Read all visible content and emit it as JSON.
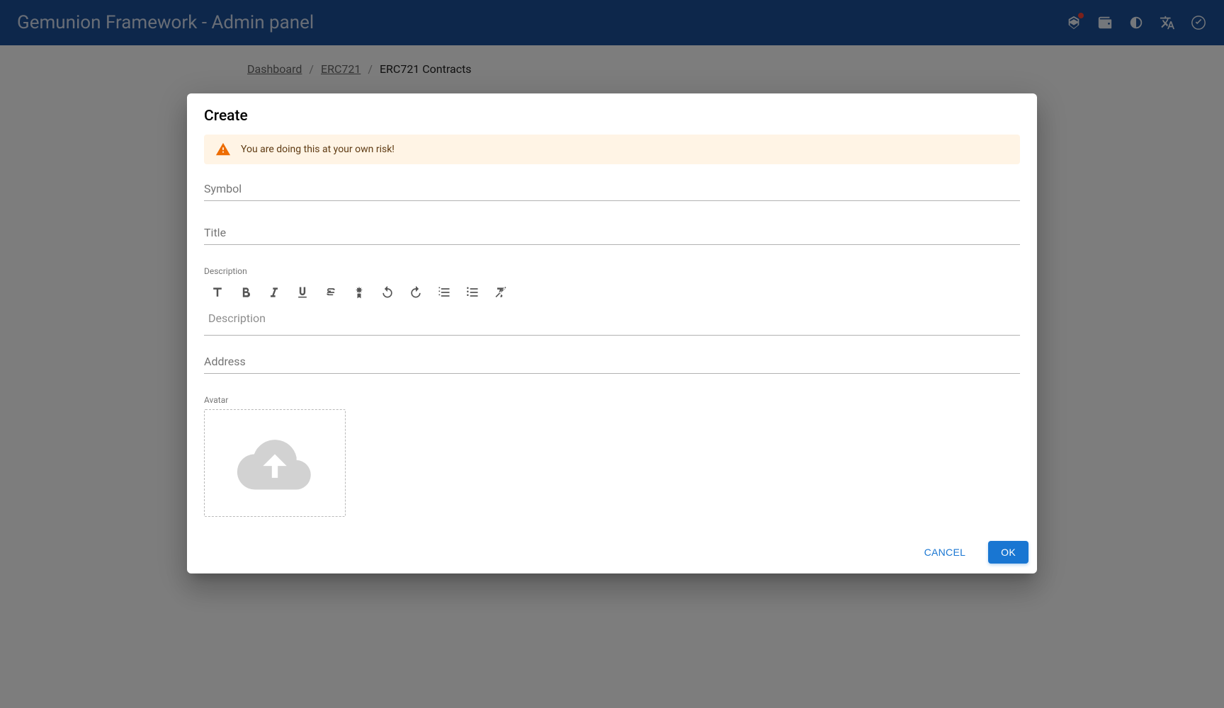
{
  "header": {
    "title": "Gemunion Framework - Admin panel"
  },
  "breadcrumb": {
    "items": [
      "Dashboard",
      "ERC721",
      "ERC721 Contracts"
    ]
  },
  "dialog": {
    "title": "Create",
    "warning": "You are doing this at your own risk!",
    "fields": {
      "symbol_label": "Symbol",
      "title_label": "Title",
      "description_label": "Description",
      "description_placeholder": "Description",
      "address_label": "Address",
      "avatar_label": "Avatar"
    },
    "actions": {
      "cancel": "CANCEL",
      "ok": "OK"
    }
  }
}
